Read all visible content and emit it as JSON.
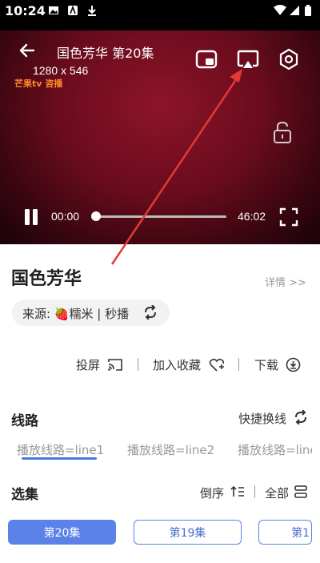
{
  "status_bar": {
    "time": "10:24"
  },
  "player": {
    "title": "国色芳华 第20集",
    "resolution": "1280 x 546",
    "logo_text": "芒果tv 咨播",
    "current_time": "00:00",
    "total_time": "46:02",
    "progress": 0
  },
  "info": {
    "show_title": "国色芳华",
    "details_label": "详情 >>",
    "source_label": "来源:",
    "source_value": "糯米 | 秒播"
  },
  "actions": {
    "cast_label": "投屏",
    "favorite_label": "加入收藏",
    "download_label": "下载"
  },
  "routes": {
    "heading": "线路",
    "quick_switch_label": "快捷换线",
    "tabs": [
      "播放线路=line1",
      "播放线路=line2",
      "播放线路=line"
    ],
    "selected_index": 0
  },
  "episodes": {
    "heading": "选集",
    "sort_label": "倒序",
    "all_label": "全部",
    "items": [
      "第20集",
      "第19集",
      "第1"
    ],
    "selected_index": 0
  },
  "colors": {
    "accent": "#5b82e8",
    "annotation_arrow": "#e53935"
  }
}
